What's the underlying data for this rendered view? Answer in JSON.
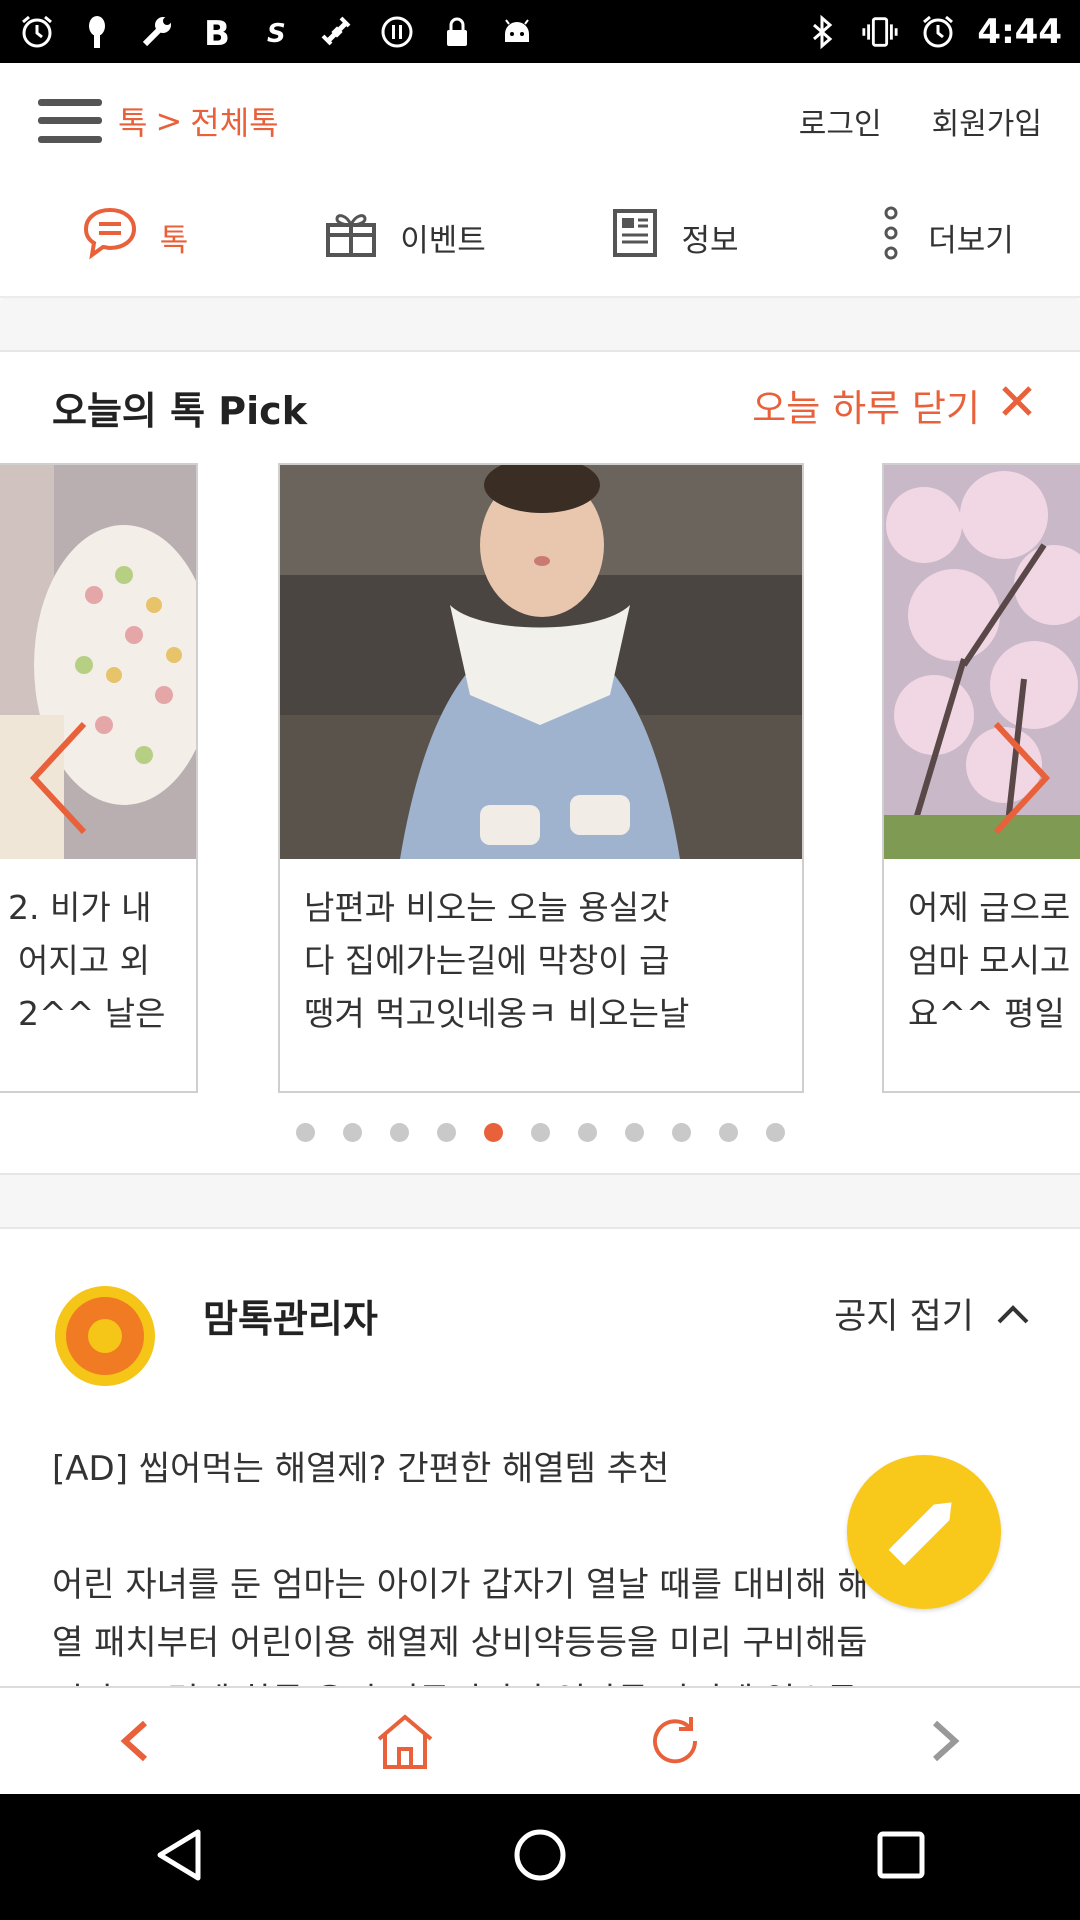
{
  "status_bar": {
    "time": "4:44",
    "left_icons": [
      "alarm-icon",
      "pin-icon",
      "wrench-icon",
      "bold-icon",
      "s-icon",
      "fake-gps-icon",
      "circle-pause-icon",
      "lock-icon",
      "android-icon"
    ],
    "right_icons": [
      "bluetooth-icon",
      "vibrate-icon",
      "alarm-icon"
    ]
  },
  "header": {
    "breadcrumb_root": "톡",
    "breadcrumb_separator": ">",
    "breadcrumb_current": "전체톡",
    "login": "로그인",
    "signup": "회원가입"
  },
  "nav": {
    "items": [
      {
        "label": "톡",
        "icon": "chat-bubble-icon",
        "active": true
      },
      {
        "label": "이벤트",
        "icon": "gift-icon",
        "active": false
      },
      {
        "label": "정보",
        "icon": "document-icon",
        "active": false
      },
      {
        "label": "더보기",
        "icon": "more-vertical-icon",
        "active": false
      }
    ]
  },
  "pick": {
    "title": "오늘의 톡 Pick",
    "close_today": "오늘 하루 닫기",
    "cards": [
      {
        "text": "2. 비가 내\n어지고 외\n2^^ 날은"
      },
      {
        "text": "남편과 비오는 오늘 용실갓\n다 집에가는길에 막창이 급\n땡겨 먹고잇네옹ㅋ 비오는날"
      },
      {
        "text": "어제 급으로\n엄마 모시고\n요^^ 평일"
      }
    ],
    "dots_count": 11,
    "active_dot": 4
  },
  "notice": {
    "author": "맘톡관리자",
    "toggle_label": "공지 접기",
    "lines": [
      "[AD] 씹어먹는 해열제? 간편한 해열템 추천",
      "",
      "어린 자녀를 둔 엄마는 아이가 갑자기 열날 때를 대비해 해",
      "열 패치부터 어린이용 해열제 상비약등등을 미리 구비해둡",
      "니다. 그런데 하루 우인 커뮤니티의 엄마들 사이에 입소문"
    ]
  },
  "colors": {
    "accent": "#e8613a",
    "fab": "#f8c81a"
  }
}
